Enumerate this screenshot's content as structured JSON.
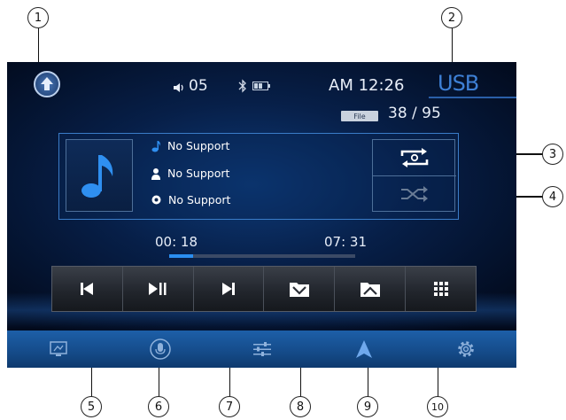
{
  "status": {
    "volume_value": "05",
    "clock": "AM 12:26",
    "source": "USB",
    "file_badge": "File",
    "file_position": "38 / 95"
  },
  "track": {
    "title": "No Support",
    "artist": "No Support",
    "album": "No Support"
  },
  "playback": {
    "elapsed": "00: 18",
    "total": "07: 31",
    "progress": 0.13
  },
  "controls": [
    {
      "name": "previous-track-button",
      "icon": "skip-previous-icon"
    },
    {
      "name": "play-pause-button",
      "icon": "play-pause-icon"
    },
    {
      "name": "next-track-button",
      "icon": "skip-next-icon"
    },
    {
      "name": "folder-down-button",
      "icon": "folder-down-icon"
    },
    {
      "name": "folder-up-button",
      "icon": "folder-up-icon"
    },
    {
      "name": "track-list-button",
      "icon": "grid-menu-icon"
    }
  ],
  "bottom_nav": [
    {
      "name": "display-nav",
      "icon": "display-icon"
    },
    {
      "name": "voice-nav",
      "icon": "microphone-icon"
    },
    {
      "name": "equalizer-nav",
      "icon": "equalizer-icon"
    },
    {
      "name": "navigation-nav",
      "icon": "navigation-arrow-icon"
    },
    {
      "name": "settings-nav",
      "icon": "gear-icon"
    }
  ],
  "callouts": [
    "1",
    "2",
    "3",
    "4",
    "5",
    "6",
    "7",
    "8",
    "9",
    "10"
  ],
  "colors": {
    "screen_bg": "#071f48",
    "accent": "#2b8ef0",
    "usb_label": "#3e80d6",
    "bottom_bar": "#1d5fa8"
  }
}
